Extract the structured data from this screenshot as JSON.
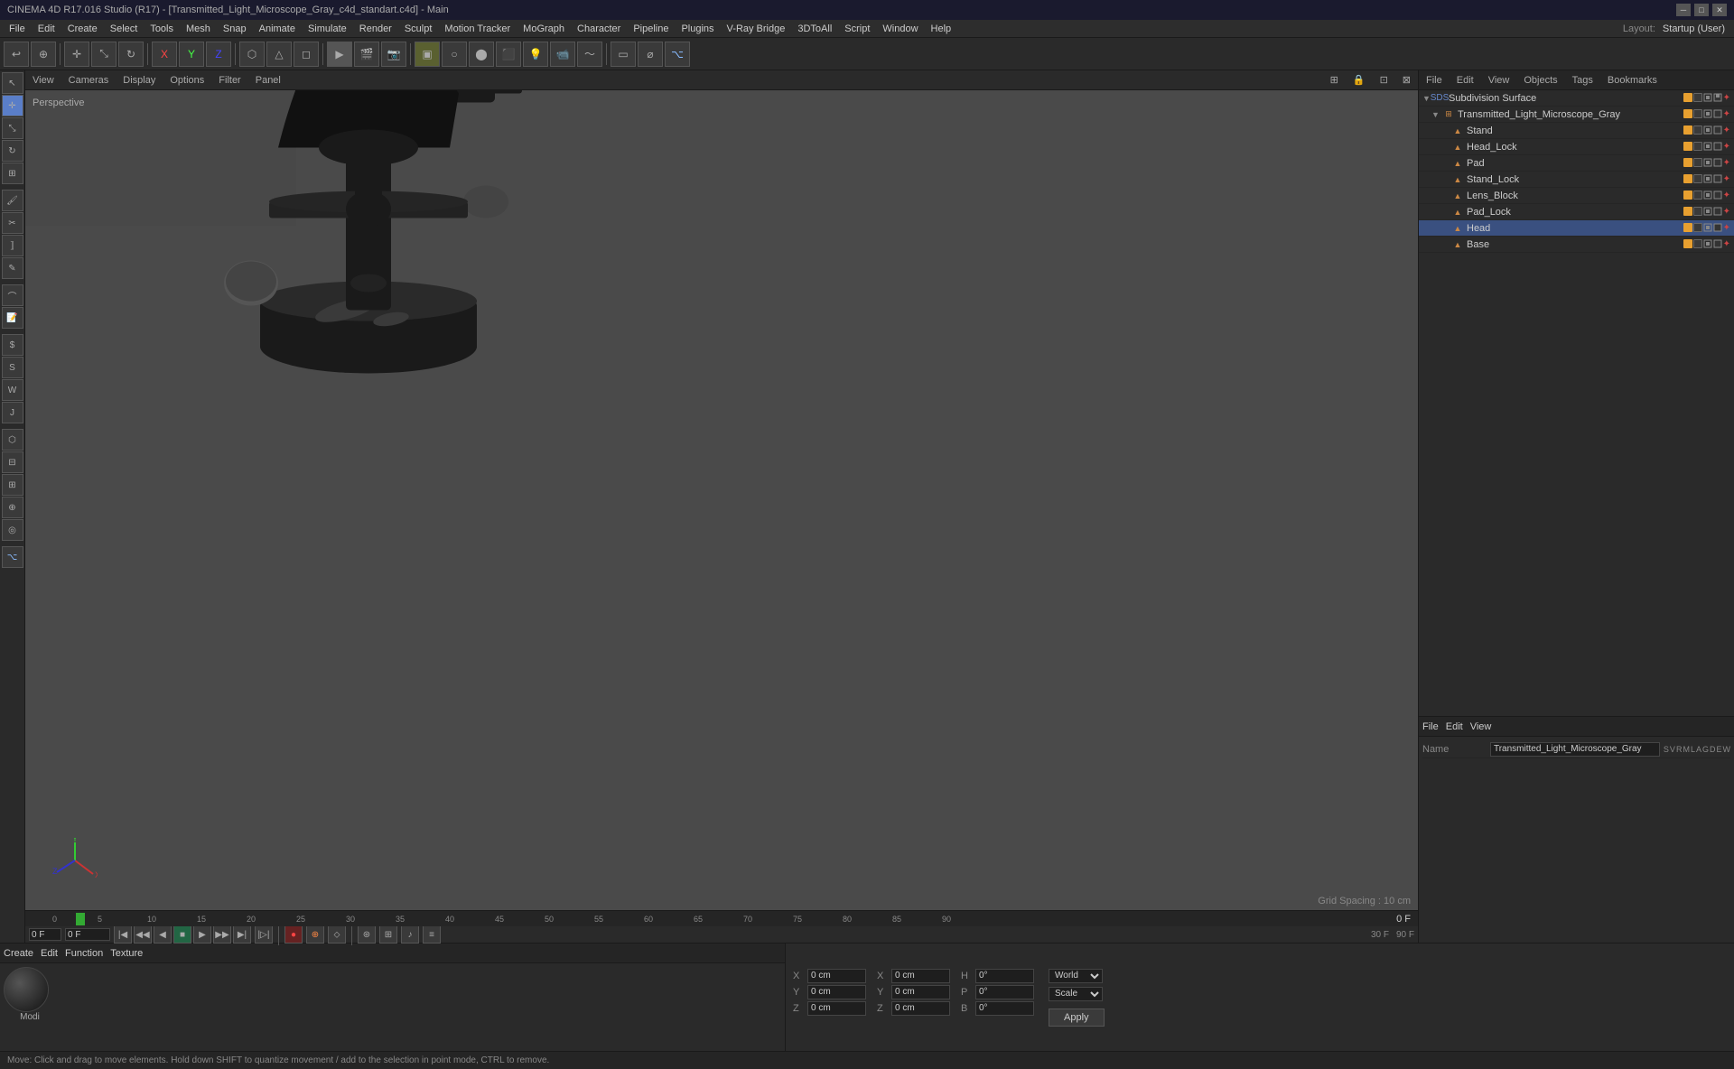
{
  "titlebar": {
    "text": "CINEMA 4D R17.016 Studio (R17) - [Transmitted_Light_Microscope_Gray_c4d_standart.c4d] - Main",
    "minimize": "─",
    "maximize": "□",
    "close": "✕"
  },
  "menubar": {
    "items": [
      "File",
      "Edit",
      "Create",
      "Select",
      "Tools",
      "Mesh",
      "Snap",
      "Animate",
      "Simulate",
      "Render",
      "Sculpt",
      "Motion Tracker",
      "MoGraph",
      "Character",
      "Pipeline",
      "Plugins",
      "V-Ray Bridge",
      "3DToAll",
      "Script",
      "Window",
      "Help"
    ]
  },
  "layout": {
    "label": "Layout:",
    "value": "Startup (User)"
  },
  "toolbar": {
    "icons": [
      "↩",
      "⊕",
      "○",
      "△",
      "◇",
      "✕",
      "✦",
      "✚",
      "⬡",
      "▶",
      "◈",
      "⌗",
      "🖌",
      "⬟",
      "⬣",
      "✦",
      "⬛",
      "⚙",
      "🔑",
      "⟳",
      "✦",
      "🎬",
      "📐",
      "⬛",
      "📷",
      "🎨",
      "🔵",
      "🔧",
      "⚡",
      "🌊"
    ]
  },
  "viewport": {
    "label": "Perspective",
    "toolbar_items": [
      "View",
      "Cameras",
      "Display",
      "Options",
      "Filter",
      "Panel"
    ],
    "grid_spacing": "Grid Spacing : 10 cm",
    "viewport_icons": [
      "⊞",
      "🔒",
      "⊡",
      "⊠"
    ]
  },
  "object_manager": {
    "header_tabs": [
      "File",
      "Edit",
      "View",
      "Objects",
      "Tags",
      "Bookmarks"
    ],
    "objects": [
      {
        "name": "Subdivision Surface",
        "indent": 0,
        "icon": "SDS",
        "icon_color": "#6688cc",
        "expanded": true,
        "dots": [
          "#e8a030",
          "#3a3a3a",
          "#999",
          "#999",
          "#999",
          "#999"
        ]
      },
      {
        "name": "Transmitted_Light_Microscope_Gray",
        "indent": 1,
        "icon": "GRP",
        "icon_color": "#cc8844",
        "expanded": true,
        "dots": [
          "#e8a030",
          "#3a3a3a",
          "#999",
          "#999",
          "#999",
          "#999"
        ]
      },
      {
        "name": "Stand",
        "indent": 2,
        "icon": "OBJ",
        "icon_color": "#cc8844",
        "expanded": false,
        "dots": [
          "#e8a030",
          "#3a3a3a",
          "#999",
          "#999",
          "#999",
          "#999"
        ]
      },
      {
        "name": "Head_Lock",
        "indent": 2,
        "icon": "OBJ",
        "icon_color": "#cc8844",
        "expanded": false,
        "dots": [
          "#e8a030",
          "#3a3a3a",
          "#999",
          "#999",
          "#999",
          "#999"
        ]
      },
      {
        "name": "Pad",
        "indent": 2,
        "icon": "OBJ",
        "icon_color": "#cc8844",
        "expanded": false,
        "dots": [
          "#e8a030",
          "#3a3a3a",
          "#999",
          "#999",
          "#999",
          "#999"
        ]
      },
      {
        "name": "Stand_Lock",
        "indent": 2,
        "icon": "OBJ",
        "icon_color": "#cc8844",
        "expanded": false,
        "dots": [
          "#e8a030",
          "#3a3a3a",
          "#999",
          "#999",
          "#999",
          "#999"
        ]
      },
      {
        "name": "Lens_Block",
        "indent": 2,
        "icon": "OBJ",
        "icon_color": "#cc8844",
        "expanded": false,
        "dots": [
          "#e8a030",
          "#3a3a3a",
          "#999",
          "#999",
          "#999",
          "#999"
        ]
      },
      {
        "name": "Pad_Lock",
        "indent": 2,
        "icon": "OBJ",
        "icon_color": "#cc8844",
        "expanded": false,
        "dots": [
          "#e8a030",
          "#3a3a3a",
          "#999",
          "#999",
          "#999",
          "#999"
        ]
      },
      {
        "name": "Head",
        "indent": 2,
        "icon": "OBJ",
        "icon_color": "#cc8844",
        "selected": true,
        "expanded": false,
        "dots": [
          "#e8a030",
          "#3a3a3a",
          "#999",
          "#999",
          "#999",
          "#999"
        ]
      },
      {
        "name": "Base",
        "indent": 2,
        "icon": "OBJ",
        "icon_color": "#cc8844",
        "expanded": false,
        "dots": [
          "#e8a030",
          "#3a3a3a",
          "#999",
          "#999",
          "#999",
          "#999"
        ]
      }
    ]
  },
  "attr_manager": {
    "header_tabs": [
      "File",
      "Edit",
      "View"
    ],
    "name_row": {
      "label": "Name",
      "value": "Transmitted_Light_Microscope_Gray"
    },
    "coord_labels": {
      "s": "S",
      "v": "V",
      "r": "R",
      "m": "M",
      "l": "L",
      "a": "A",
      "g": "G",
      "d": "D",
      "e": "E",
      "w": "W"
    }
  },
  "bottom_panel": {
    "tabs": [
      "Create",
      "Edit",
      "Function",
      "Texture"
    ],
    "material_name": "Modi"
  },
  "coordinates": {
    "x_label": "X",
    "y_label": "Y",
    "z_label": "Z",
    "x_val": "0 cm",
    "y_val": "0 cm",
    "z_val": "0 cm",
    "px_label": "X",
    "py_label": "Y",
    "pz_label": "Z",
    "px_val": "0 cm",
    "py_val": "0 cm",
    "pz_val": "0 cm",
    "sx_label": "H",
    "sy_label": "P",
    "sz_label": "B",
    "sx_val": "0°",
    "sy_val": "0°",
    "sz_val": "0°",
    "world_label": "World",
    "scale_label": "Scale",
    "apply_label": "Apply"
  },
  "timeline": {
    "start_frame": "0 F",
    "current_frame": "0 F",
    "end_frame": "90 F",
    "fps": "30 F",
    "markers": [
      0,
      5,
      10,
      15,
      20,
      25,
      30,
      35,
      40,
      45,
      50,
      55,
      60,
      65,
      70,
      75,
      80,
      85,
      90
    ]
  },
  "status_bar": {
    "text": "Move: Click and drag to move elements. Hold down SHIFT to quantize movement / add to the selection in point mode, CTRL to remove."
  }
}
